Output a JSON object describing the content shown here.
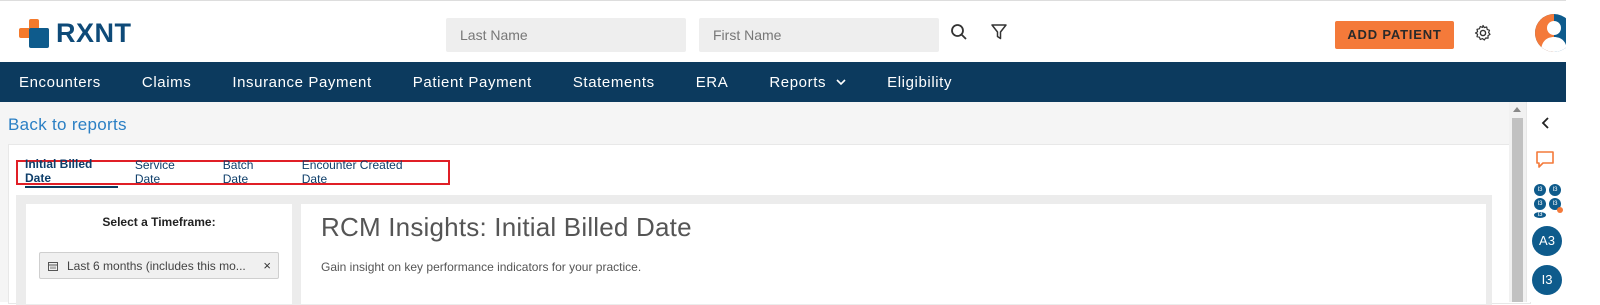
{
  "header": {
    "logo_text": "RXNT",
    "last_name_placeholder": "Last Name",
    "first_name_placeholder": "First Name",
    "add_patient_label": "ADD PATIENT",
    "brand_color": "#f47a3a",
    "primary_color": "#0c3a5e"
  },
  "nav": {
    "items": [
      "Encounters",
      "Claims",
      "Insurance Payment",
      "Patient Payment",
      "Statements",
      "ERA",
      "Reports",
      "Eligibility"
    ]
  },
  "content": {
    "back_link": "Back to reports",
    "tabs": [
      "Initial Billed Date",
      "Service Date",
      "Batch Date",
      "Encounter Created Date"
    ],
    "timeframe_title": "Select a Timeframe:",
    "timeframe_value": "Last 6 months (includes this mo...",
    "clear_symbol": "×",
    "main_title": "RCM Insights: Initial Billed Date",
    "main_subtitle": "Gain insight on key performance indicators for your practice."
  },
  "right_sidebar": {
    "mini_badges": [
      "I3",
      "I3",
      "I3",
      "I3",
      "I3"
    ],
    "bubbles": [
      "A3",
      "I3"
    ]
  }
}
